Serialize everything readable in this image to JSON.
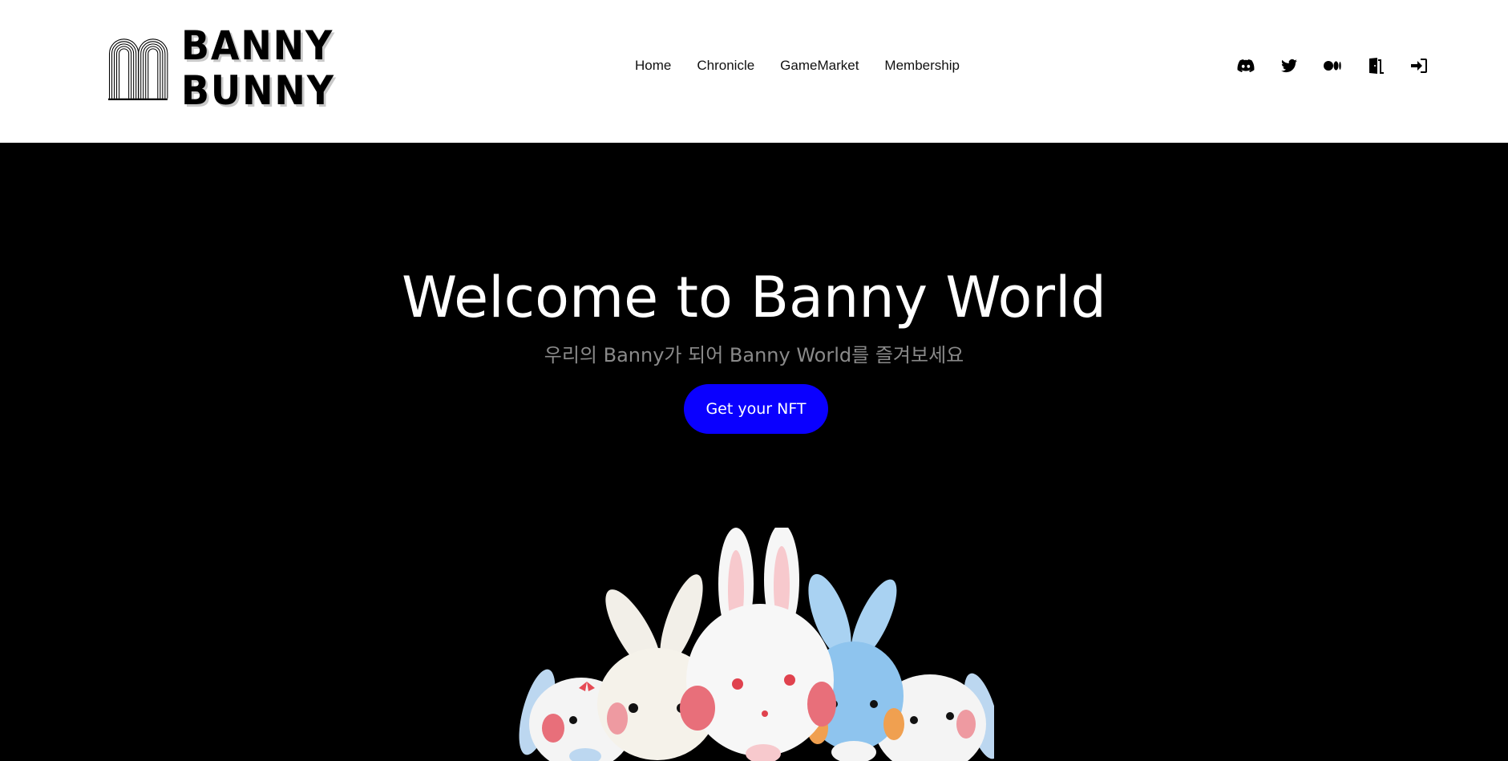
{
  "brand": {
    "line1": "BANNY",
    "line2": "BUNNY"
  },
  "nav": {
    "items": [
      {
        "label": "Home"
      },
      {
        "label": "Chronicle"
      },
      {
        "label": "GameMarket"
      },
      {
        "label": "Membership"
      }
    ]
  },
  "header_icons": [
    "discord-icon",
    "twitter-icon",
    "medium-icon",
    "door-icon",
    "sign-in-icon"
  ],
  "hero": {
    "title": "Welcome to Banny World",
    "subtitle": "우리의 Banny가 되어 Banny World를 즐겨보세요",
    "cta_label": "Get your NFT"
  },
  "colors": {
    "cta_bg": "#0a00ff",
    "hero_bg": "#000000",
    "header_bg": "#ffffff"
  }
}
